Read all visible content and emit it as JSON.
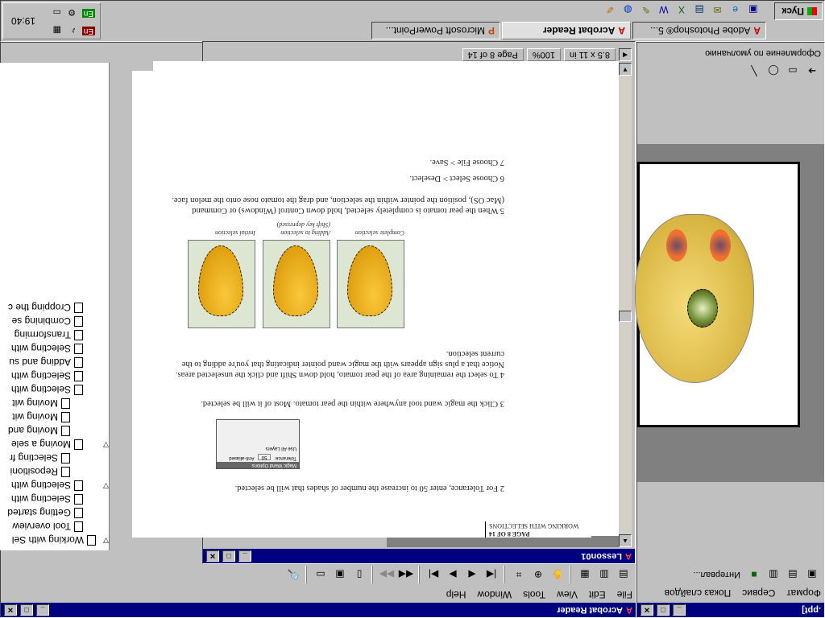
{
  "taskbar": {
    "start_label": "Пуск",
    "tasks": [
      "Adobe Photoshop® 5...",
      "Acrobat Reader",
      "Microsoft PowerPoint..."
    ],
    "clock": "19:40",
    "lang1": "En",
    "lang2": "En"
  },
  "acrobat": {
    "window_title": "Acrobat Reader",
    "menu": [
      "File",
      "Edit",
      "View",
      "Tools",
      "Window",
      "Help"
    ],
    "doc_title": "Lesson01",
    "status": {
      "page": "Page 8 of 14",
      "zoom": "100%",
      "size": "8.5 x 11 in"
    },
    "bookmarks": [
      {
        "text": "Working with Sel",
        "level": 0,
        "expander": "▽"
      },
      {
        "text": "Tool overview",
        "level": 1
      },
      {
        "text": "Getting started",
        "level": 1
      },
      {
        "text": "Selecting with",
        "level": 1
      },
      {
        "text": "Selecting with",
        "level": 1,
        "expander": "▽"
      },
      {
        "text": "Repositioni",
        "level": 2
      },
      {
        "text": "Selecting fr",
        "level": 2
      },
      {
        "text": "Moving a sele",
        "level": 1,
        "expander": "▽"
      },
      {
        "text": "Moving and",
        "level": 2
      },
      {
        "text": "Moving wit",
        "level": 2
      },
      {
        "text": "Moving wit",
        "level": 2
      },
      {
        "text": "Selecting with",
        "level": 1
      },
      {
        "text": "Selecting with",
        "level": 1
      },
      {
        "text": "Adding and su",
        "level": 1
      },
      {
        "text": "Selecting with",
        "level": 1
      },
      {
        "text": "Transforming",
        "level": 1
      },
      {
        "text": "Combining se",
        "level": 1
      },
      {
        "text": "Cropping the c",
        "level": 1
      }
    ]
  },
  "page": {
    "header_line1": "WORKING WITH SELECTIONS",
    "header_line2": "PAGE 8 OF 14",
    "step2": "2  For Tolerance, enter 50 to increase the number of shades that will be selected.",
    "panel_title": "Magic Wand Options",
    "panel_row1": "Tolerance:",
    "panel_row1_value": "50",
    "panel_row1_right": "Anti-aliased",
    "panel_row2": "Use All Layers",
    "step3": "3  Click the magic wand tool anywhere within the pear tomato. Most of it will be selected.",
    "step4a": "4  To select the remaining area of the pear tomato, hold down Shift and click the unselected areas.",
    "step4b": "Notice that a plus sign appears with the magic wand pointer indicating that you're adding to the",
    "step4c": "current selection.",
    "caption1": "Initial selection",
    "caption2a": "Adding to selection",
    "caption2b": "(Shift key depressed)",
    "caption3": "Complete selection",
    "step5a": "5  When the pear tomato is completely selected, hold down Control (Windows) or Command",
    "step5b": "(Mac OS), position the pointer within the selection, and drag the tomato nose onto the melon face.",
    "step6": "6  Choose Select > Deselect.",
    "step7": "7  Choose File > Save."
  },
  "powerpoint": {
    "title": ".ppt]",
    "menu": [
      "Формат",
      "Сервис",
      "Показ слайдов"
    ],
    "design_label": "Оформление по умолчанию",
    "animation_label": "Интервал..."
  }
}
